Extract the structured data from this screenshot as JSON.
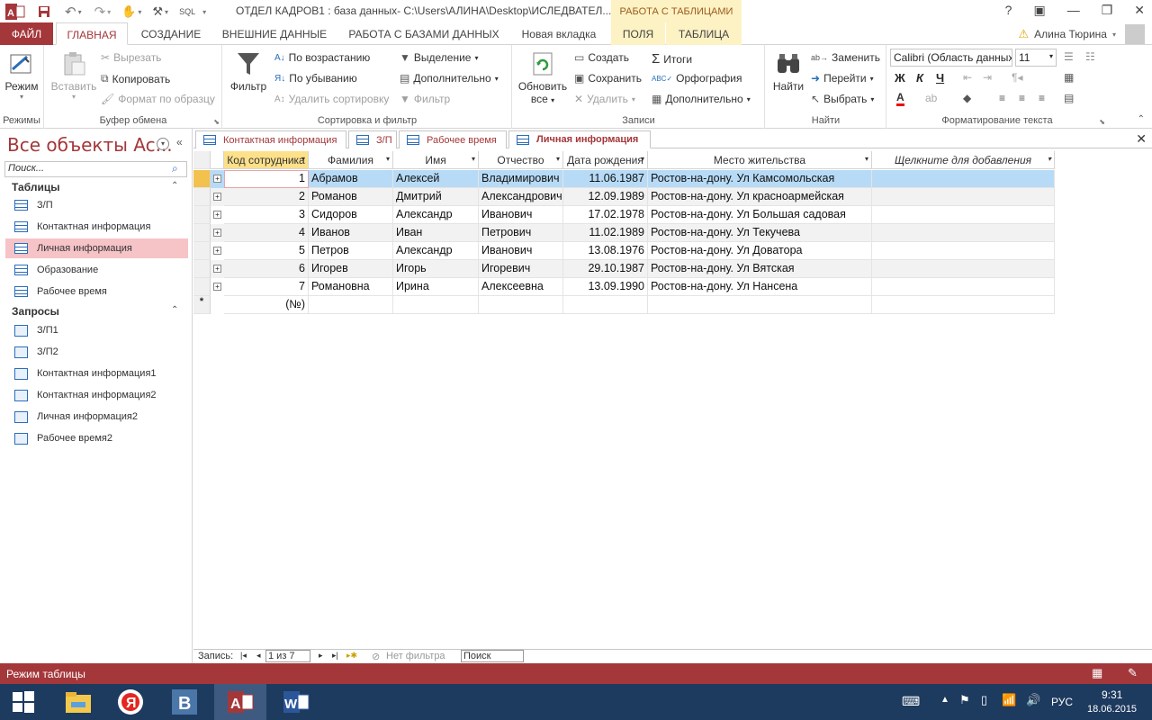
{
  "titlebar": {
    "app_title": "ОТДЕЛ КАДРОВ1 : база данных- C:\\Users\\АЛИНА\\Desktop\\ИСЛЕДВАТЕЛ...",
    "context_tab_header": "РАБОТА С ТАБЛИЦАМИ",
    "qat_sql": "SQL"
  },
  "tabs": {
    "file": "ФАЙЛ",
    "home": "ГЛАВНАЯ",
    "create": "СОЗДАНИЕ",
    "external": "ВНЕШНИЕ ДАННЫЕ",
    "database": "РАБОТА С БАЗАМИ ДАННЫХ",
    "new_tab": "Новая вкладка",
    "fields": "ПОЛЯ",
    "table": "ТАБЛИЦА",
    "user": "Алина Тюрина"
  },
  "ribbon": {
    "views": {
      "mode": "Режим",
      "group": "Режимы"
    },
    "clipboard": {
      "paste": "Вставить",
      "cut": "Вырезать",
      "copy": "Копировать",
      "format_painter": "Формат по образцу",
      "group": "Буфер обмена"
    },
    "sort_filter": {
      "filter": "Фильтр",
      "ascending": "По возрастанию",
      "descending": "По убыванию",
      "remove_sort": "Удалить сортировку",
      "selection": "Выделение",
      "advanced": "Дополнительно",
      "toggle_filter": "Фильтр",
      "group": "Сортировка и фильтр"
    },
    "records": {
      "refresh": "Обновить",
      "refresh_all": "все",
      "new": "Создать",
      "save": "Сохранить",
      "delete": "Удалить",
      "totals": "Итоги",
      "spelling": "Орфография",
      "more": "Дополнительно",
      "group": "Записи"
    },
    "find": {
      "find": "Найти",
      "replace": "Заменить",
      "goto": "Перейти",
      "select": "Выбрать",
      "group": "Найти"
    },
    "text_format": {
      "font": "Calibri (Область данных)",
      "size": "11",
      "bold": "Ж",
      "italic": "К",
      "underline": "Ч",
      "group": "Форматирование текста"
    }
  },
  "nav": {
    "title": "Все объекты Ac...",
    "search_placeholder": "Поиск...",
    "tables_header": "Таблицы",
    "tables": [
      "З/П",
      "Контактная информация",
      "Личная информация",
      "Образование",
      "Рабочее время"
    ],
    "queries_header": "Запросы",
    "queries": [
      "З/П1",
      "З/П2",
      "Контактная информация1",
      "Контактная информация2",
      "Личная информация2",
      "Рабочее время2"
    ]
  },
  "doc_tabs": [
    "Контактная информация",
    "З/П",
    "Рабочее время",
    "Личная информация"
  ],
  "grid": {
    "columns": [
      "Код сотрудника",
      "Фамилия",
      "Имя",
      "Отчество",
      "Дата рождения",
      "Место жительства",
      "Щелкните для добавления"
    ],
    "rows": [
      [
        "1",
        "Абрамов",
        "Алексей",
        "Владимирович",
        "11.06.1987",
        "Ростов-на-дону. Ул Камсомольская"
      ],
      [
        "2",
        "Романов",
        "Дмитрий",
        "Александрович",
        "12.09.1989",
        "Ростов-на-дону. Ул красноармейская"
      ],
      [
        "3",
        "Сидоров",
        "Александр",
        "Иванович",
        "17.02.1978",
        "Ростов-на-дону. Ул Большая садовая"
      ],
      [
        "4",
        "Иванов",
        "Иван",
        "Петрович",
        "11.02.1989",
        "Ростов-на-дону. Ул Текучева"
      ],
      [
        "5",
        "Петров",
        "Александр",
        "Иванович",
        "13.08.1976",
        "Ростов-на-дону. Ул Доватора"
      ],
      [
        "6",
        "Игорев",
        "Игорь",
        "Игоревич",
        "29.10.1987",
        "Ростов-на-дону. Ул Вятская"
      ],
      [
        "7",
        "Романовна",
        "Ирина",
        "Алексеевна",
        "13.09.1990",
        "Ростов-на-дону. Ул Нансена"
      ]
    ],
    "new_row_marker": "*",
    "new_row_id": "(№)"
  },
  "record_nav": {
    "label": "Запись:",
    "current": "1 из 7",
    "no_filter": "Нет фильтра",
    "search": "Поиск"
  },
  "status": {
    "mode": "Режим таблицы"
  },
  "taskbar": {
    "lang": "РУС",
    "time": "9:31",
    "date": "18.06.2015"
  },
  "colors": {
    "accent": "#a4373a",
    "selected_nav": "#f6c3c7",
    "key_header": "#fce08a",
    "selected_row": "#b7dbf7",
    "context_tab": "#fdf2c4",
    "taskbar": "#1d3a5f"
  }
}
